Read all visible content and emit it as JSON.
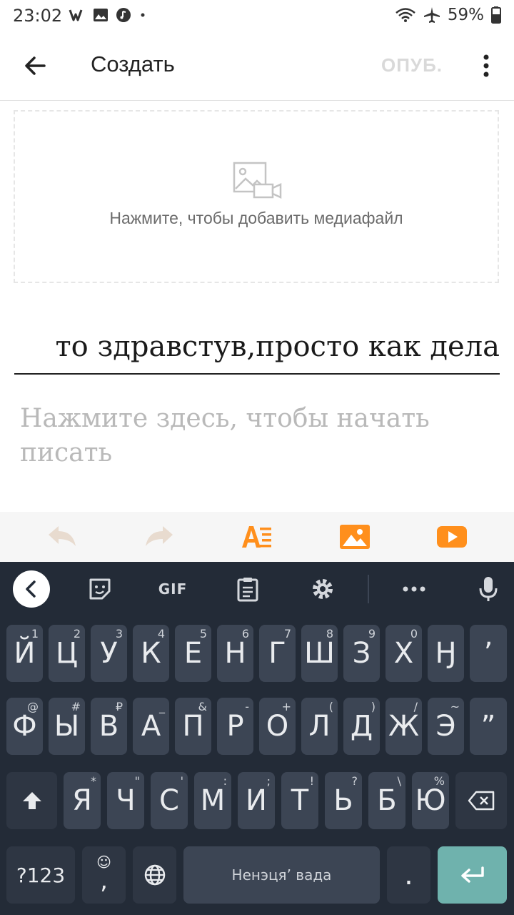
{
  "status_bar": {
    "time": "23:02",
    "battery": "59%",
    "left_icons": [
      "wattpad-icon",
      "image-icon",
      "music-icon",
      "dot-icon"
    ],
    "right_icons": [
      "wifi-icon",
      "airplane-icon",
      "battery-icon"
    ]
  },
  "app_bar": {
    "title": "Создать",
    "publish_label": "ОПУБ."
  },
  "media": {
    "prompt": "Нажмите, чтобы добавить медиафайл"
  },
  "editor": {
    "title_value": "то здравстув,просто как дела",
    "body_placeholder": "Нажмите здесь, чтобы начать писать"
  },
  "format_bar": {
    "items": [
      "undo-icon",
      "redo-icon",
      "text-format-icon",
      "insert-image-icon",
      "insert-video-icon"
    ],
    "accent": "#ff8f1c"
  },
  "keyboard": {
    "toolbar": [
      "collapse-icon",
      "sticker-icon",
      "GIF",
      "clipboard-icon",
      "settings-icon",
      "more-icon",
      "mic-icon"
    ],
    "row1": [
      {
        "k": "Й",
        "h": "1"
      },
      {
        "k": "Ц",
        "h": "2"
      },
      {
        "k": "У",
        "h": "3"
      },
      {
        "k": "К",
        "h": "4"
      },
      {
        "k": "Е",
        "h": "5"
      },
      {
        "k": "Н",
        "h": "6"
      },
      {
        "k": "Г",
        "h": "7"
      },
      {
        "k": "Ш",
        "h": "8"
      },
      {
        "k": "З",
        "h": "9"
      },
      {
        "k": "Х",
        "h": "0"
      },
      {
        "k": "Ӈ",
        "h": ""
      },
      {
        "k": "’",
        "h": ""
      }
    ],
    "row2": [
      {
        "k": "Ф",
        "h": "@"
      },
      {
        "k": "Ы",
        "h": "#"
      },
      {
        "k": "В",
        "h": "₽"
      },
      {
        "k": "А",
        "h": "_"
      },
      {
        "k": "П",
        "h": "&"
      },
      {
        "k": "Р",
        "h": "-"
      },
      {
        "k": "О",
        "h": "+"
      },
      {
        "k": "Л",
        "h": "("
      },
      {
        "k": "Д",
        "h": ")"
      },
      {
        "k": "Ж",
        "h": "/"
      },
      {
        "k": "Э",
        "h": "~"
      },
      {
        "k": "”",
        "h": ""
      }
    ],
    "row3": [
      {
        "k": "Я",
        "h": "*"
      },
      {
        "k": "Ч",
        "h": "\""
      },
      {
        "k": "С",
        "h": "'"
      },
      {
        "k": "М",
        "h": ":"
      },
      {
        "k": "И",
        "h": ";"
      },
      {
        "k": "Т",
        "h": "!"
      },
      {
        "k": "Ь",
        "h": "?"
      },
      {
        "k": "Б",
        "h": "\\"
      },
      {
        "k": "Ю",
        "h": "%"
      }
    ],
    "numbers_label": "?123",
    "emoji_comma": ",",
    "emoji_symbol": "☺",
    "space_label": "Ненэця’ вада",
    "period": ".",
    "colors": {
      "background": "#232b37",
      "key": "#3c4554",
      "enter": "#6fb2ad"
    }
  }
}
